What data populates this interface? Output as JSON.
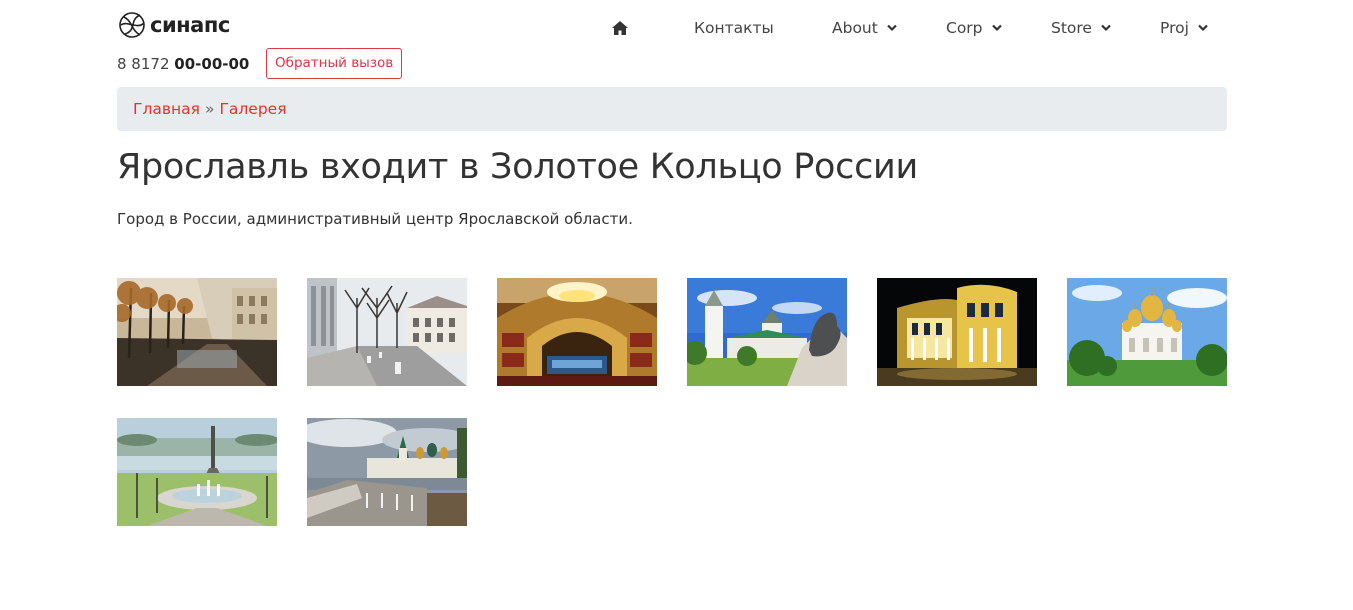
{
  "header": {
    "logo_text": "синапс",
    "phone_prefix": "8 8172",
    "phone_number": "00-00-00",
    "callback_label": "Обратный вызов"
  },
  "nav": {
    "home_icon": "home-icon",
    "items": [
      {
        "label": "Контакты",
        "dropdown": false
      },
      {
        "label": "About",
        "dropdown": true
      },
      {
        "label": "Corp",
        "dropdown": true
      },
      {
        "label": "Store",
        "dropdown": true
      },
      {
        "label": "Proj",
        "dropdown": true
      }
    ]
  },
  "breadcrumb": {
    "items": [
      "Главная",
      "Галерея"
    ],
    "separator": "»"
  },
  "page": {
    "title": "Ярославль входит в Золотое Кольцо России",
    "description": "Город в России, административный центр Ярославской области."
  },
  "gallery": {
    "images": [
      "autumn-street-photo",
      "city-street-photo",
      "theatre-interior-photo",
      "bear-monument-monastery-photo",
      "theatre-night-photo",
      "cathedral-golden-domes-photo",
      "strelka-fountain-photo",
      "kremlin-embankment-photo"
    ]
  },
  "colors": {
    "accent": "#dc3545",
    "link": "#e0352b",
    "breadcrumb_bg": "#e9ecef",
    "text": "#333333"
  }
}
